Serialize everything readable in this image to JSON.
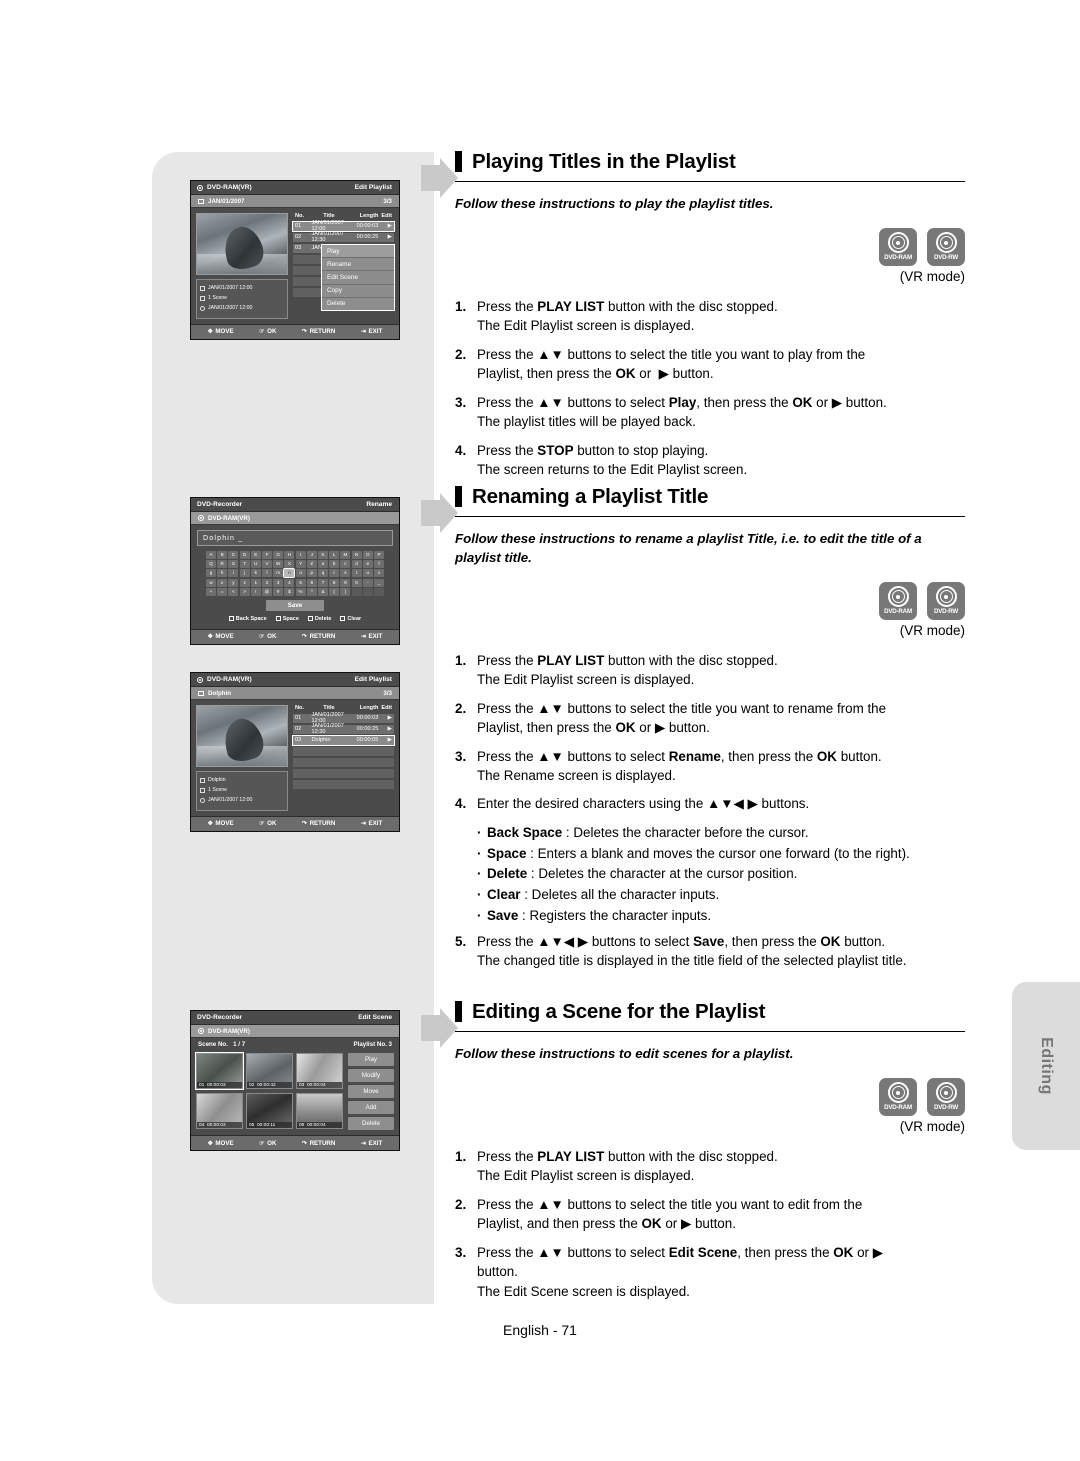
{
  "page": {
    "footer": "English - 71",
    "side_tab": "Editing"
  },
  "sections": [
    {
      "id": "playing-titles",
      "heading": "Playing Titles in the Playlist",
      "intro": "Follow these instructions to play the playlist titles.",
      "vr_mode": "(VR mode)",
      "discs": [
        {
          "label": "DVD-RAM",
          "name": "dvd-ram-logo"
        },
        {
          "label": "DVD-RW",
          "name": "dvd-rw-logo"
        }
      ],
      "steps": [
        {
          "num": "1.",
          "html": "Press the <b>PLAY LIST</b> button with the disc stopped.<br>The Edit Playlist screen is displayed."
        },
        {
          "num": "2.",
          "html": "Press the ▲▼ buttons to select the title you want to play from the<br>Playlist, then press the <b>OK</b> or&nbsp; ▶ button."
        },
        {
          "num": "3.",
          "html": "Press the ▲▼ buttons to select <b>Play</b>, then press the <b>OK</b> or ▶ button.<br>The playlist titles will be played back."
        },
        {
          "num": "4.",
          "html": "Press the <b>STOP</b> button to stop playing.<br>The screen returns to the Edit Playlist screen."
        }
      ]
    },
    {
      "id": "renaming-playlist",
      "heading": "Renaming a Playlist Title",
      "intro": "Follow these instructions to rename a playlist Title, i.e. to edit the title of a playlist title.",
      "vr_mode": "(VR mode)",
      "discs": [
        {
          "label": "DVD-RAM",
          "name": "dvd-ram-logo"
        },
        {
          "label": "DVD-RW",
          "name": "dvd-rw-logo"
        }
      ],
      "steps": [
        {
          "num": "1.",
          "html": "Press the <b>PLAY LIST</b> button with the disc stopped.<br>The Edit Playlist screen is displayed."
        },
        {
          "num": "2.",
          "html": "Press the ▲▼ buttons to select the title you want to rename from the<br>Playlist, then press the <b>OK</b> or ▶ button."
        },
        {
          "num": "3.",
          "html": "Press the ▲▼ buttons to select <b>Rename</b>, then press the <b>OK</b> button.<br>The Rename screen is displayed."
        },
        {
          "num": "4.",
          "html": "Enter the desired characters using the ▲▼◀ ▶ buttons."
        }
      ],
      "bullets": [
        {
          "html": "<b>Back Space</b> : Deletes the character before the cursor."
        },
        {
          "html": "<b>Space</b> : Enters a blank and moves the cursor one forward (to the right)."
        },
        {
          "html": "<b>Delete</b> : Deletes the character at the cursor position."
        },
        {
          "html": "<b>Clear</b> : Deletes all the character inputs."
        },
        {
          "html": "<b>Save</b> : Registers the character inputs."
        }
      ],
      "steps_after": [
        {
          "num": "5.",
          "html": "Press the ▲▼◀ ▶ buttons to select <b>Save</b>, then press the <b>OK</b> button.<br>The changed title is displayed in the title field of the selected playlist title."
        }
      ]
    },
    {
      "id": "editing-scene",
      "heading": "Editing a Scene for the Playlist",
      "intro": "Follow these instructions to edit scenes for a playlist.",
      "vr_mode": "(VR mode)",
      "discs": [
        {
          "label": "DVD-RAM",
          "name": "dvd-ram-logo"
        },
        {
          "label": "DVD-RW",
          "name": "dvd-rw-logo"
        }
      ],
      "steps": [
        {
          "num": "1.",
          "html": "Press the <b>PLAY LIST</b> button with the disc stopped.<br>The Edit Playlist screen is displayed."
        },
        {
          "num": "2.",
          "html": "Press the ▲▼ buttons to select the title you want to edit from the<br>Playlist, and then press the <b>OK</b> or ▶ button."
        },
        {
          "num": "3.",
          "html": "Press the ▲▼ buttons to select <b>Edit Scene</b>, then press the <b>OK</b> or ▶<br>button.<br>The Edit Scene screen is displayed."
        }
      ]
    }
  ],
  "osd_nav": [
    {
      "icon": "dpad-icon",
      "label": "MOVE"
    },
    {
      "icon": "ok-icon",
      "label": "OK"
    },
    {
      "icon": "return-icon",
      "label": "RETURN"
    },
    {
      "icon": "exit-icon",
      "label": "EXIT"
    }
  ],
  "screens": {
    "edit_playlist_1": {
      "device": "DVD-RAM(VR)",
      "screen_title": "Edit Playlist",
      "sub_title": "JAN/01/2007",
      "sub_counter": "3/3",
      "columns": [
        "No.",
        "Title",
        "Length",
        "Edit"
      ],
      "rows": [
        {
          "no": "01",
          "title": "JAN/01/2007 12:00",
          "length": "00:00:03",
          "edit": "▶",
          "selected": true
        },
        {
          "no": "02",
          "title": "JAN/01/2007 12:30",
          "length": "00:00:25",
          "edit": "▶",
          "selected": false
        },
        {
          "no": "03",
          "title": "JAN/01/2007",
          "length": "",
          "edit": "",
          "selected": false
        }
      ],
      "meta": [
        {
          "icon": "calendar-icon",
          "text": "JAN/01/2007 12:00"
        },
        {
          "icon": "scene-icon",
          "text": "1 Scene"
        },
        {
          "icon": "clock-icon",
          "text": "JAN/01/2007 12:00"
        }
      ],
      "popup": [
        "Play",
        "Rename",
        "Edit Scene",
        "Copy",
        "Delete"
      ]
    },
    "rename": {
      "device": "DVD-Recorder",
      "screen_title": "Rename",
      "sub_title": "DVD-RAM(VR)",
      "name_value": "Dolphin",
      "keyboard": [
        [
          "A",
          "B",
          "C",
          "D",
          "E",
          "F",
          "G",
          "H",
          "I",
          "J",
          "K",
          "L",
          "M",
          "N",
          "O",
          "P"
        ],
        [
          "Q",
          "R",
          "S",
          "T",
          "U",
          "V",
          "W",
          "X",
          "Y",
          "Z",
          "a",
          "b",
          "c",
          "d",
          "e",
          "f"
        ],
        [
          "g",
          "h",
          "i",
          "j",
          "k",
          "l",
          "m",
          "n",
          "o",
          "p",
          "q",
          "r",
          "s",
          "t",
          "u",
          "v"
        ],
        [
          "w",
          "x",
          "y",
          "z",
          "1",
          "2",
          "3",
          "4",
          "5",
          "6",
          "7",
          "8",
          "9",
          "0",
          "-",
          "_"
        ],
        [
          "+",
          "=",
          "<",
          ">",
          "!",
          "@",
          "#",
          "$",
          "%",
          "^",
          "&",
          "(",
          ")",
          "",
          "",
          ""
        ]
      ],
      "selected_key": "n",
      "save_label": "Save",
      "function_keys": [
        "Back Space",
        "Space",
        "Delete",
        "Clear"
      ]
    },
    "edit_playlist_2": {
      "device": "DVD-RAM(VR)",
      "screen_title": "Edit Playlist",
      "sub_title": "Dolphin",
      "sub_counter": "3/3",
      "columns": [
        "No.",
        "Title",
        "Length",
        "Edit"
      ],
      "rows": [
        {
          "no": "01",
          "title": "JAN/01/2007 12:00",
          "length": "00:00:03",
          "edit": "▶",
          "selected": false
        },
        {
          "no": "02",
          "title": "JAN/01/2007 12:30",
          "length": "00:00:25",
          "edit": "▶",
          "selected": false
        },
        {
          "no": "03",
          "title": "Dolphin",
          "length": "00:00:05",
          "edit": "▶",
          "selected": true
        }
      ],
      "meta": [
        {
          "icon": "calendar-icon",
          "text": "Dolphin"
        },
        {
          "icon": "scene-icon",
          "text": "1 Scene"
        },
        {
          "icon": "clock-icon",
          "text": "JAN/01/2007 12:00"
        }
      ]
    },
    "edit_scene": {
      "device": "DVD-Recorder",
      "screen_title": "Edit Scene",
      "sub_title": "DVD-RAM(VR)",
      "scene_no_label": "Scene No.",
      "scene_no_value": "1 / 7",
      "playlist_no": "Playlist No. 3",
      "scenes": [
        {
          "no": "01",
          "time": "00:00:03",
          "selected": true
        },
        {
          "no": "02",
          "time": "00:00:42",
          "selected": false
        },
        {
          "no": "03",
          "time": "00:00:04",
          "selected": false
        },
        {
          "no": "04",
          "time": "00:00:03",
          "selected": false
        },
        {
          "no": "05",
          "time": "00:00:11",
          "selected": false
        },
        {
          "no": "06",
          "time": "00:00:04",
          "selected": false
        }
      ],
      "buttons": [
        "Play",
        "Modify",
        "Move",
        "Add",
        "Delete"
      ]
    }
  }
}
